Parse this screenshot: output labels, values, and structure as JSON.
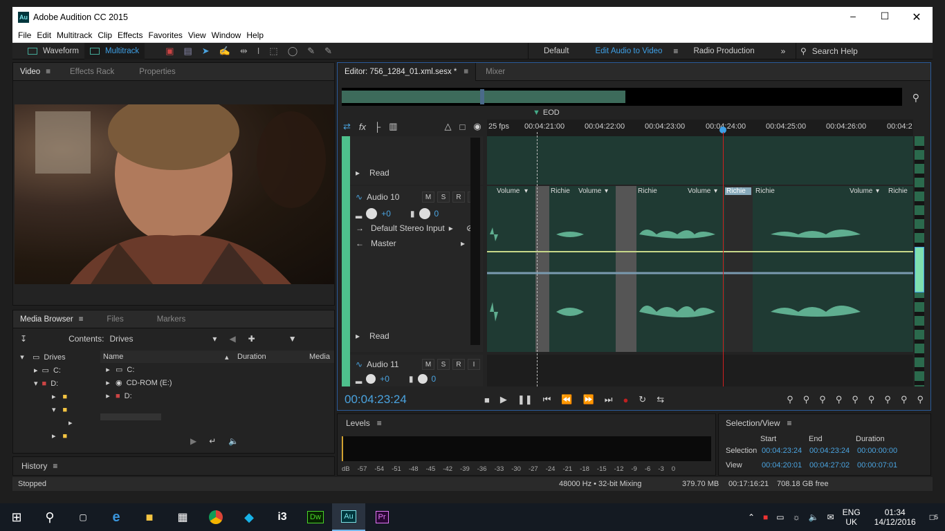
{
  "window": {
    "title": "Adobe Audition CC 2015",
    "app_badge": "Au"
  },
  "menu": [
    "File",
    "Edit",
    "Multitrack",
    "Clip",
    "Effects",
    "Favorites",
    "View",
    "Window",
    "Help"
  ],
  "toolbar": {
    "waveform": "Waveform",
    "multitrack": "Multitrack",
    "workspaces": [
      "Default",
      "Edit Audio to Video",
      "Radio Production"
    ],
    "search_help": "Search Help"
  },
  "left_tabs": {
    "video": "Video",
    "effects_rack": "Effects Rack",
    "properties": "Properties"
  },
  "media_tabs": {
    "media_browser": "Media Browser",
    "files": "Files",
    "markers": "Markers"
  },
  "media": {
    "contents_label": "Contents:",
    "contents_value": "Drives",
    "tree": {
      "drives": "Drives",
      "c": "C:",
      "d": "D:"
    },
    "columns": {
      "name": "Name",
      "duration": "Duration",
      "media": "Media"
    },
    "items": [
      "C:",
      "CD-ROM (E:)",
      "D:"
    ]
  },
  "history": "History",
  "status_left": "Stopped",
  "editor_tabs": {
    "editor": "Editor: 756_1284_01.xml.sesx *",
    "mixer": "Mixer"
  },
  "timeline": {
    "fps": "25 fps",
    "eod": "EOD",
    "ticks": [
      "00:04:21:00",
      "00:04:22:00",
      "00:04:23:00",
      "00:04:24:00",
      "00:04:25:00",
      "00:04:26:00",
      "00:04:2"
    ],
    "current_time": "00:04:23:24"
  },
  "track_top": {
    "mode": "Read"
  },
  "track_audio10": {
    "name": "Audio 10",
    "volume": "+0",
    "pan": "0",
    "input": "Default Stereo Input",
    "output": "Master",
    "mode": "Read",
    "m": "M",
    "s": "S",
    "r": "R",
    "i": "I",
    "clips": [
      "Volume",
      "Richie",
      "Volume",
      "Richie",
      "Volume",
      "Richie",
      "Richie",
      "Volume",
      "Richie"
    ]
  },
  "track_audio11": {
    "name": "Audio 11",
    "volume": "+0",
    "pan": "0",
    "m": "M",
    "s": "S",
    "r": "R",
    "i": "I"
  },
  "levels": {
    "title": "Levels",
    "scale": [
      "dB",
      "-57",
      "-54",
      "-51",
      "-48",
      "-45",
      "-42",
      "-39",
      "-36",
      "-33",
      "-30",
      "-27",
      "-24",
      "-21",
      "-18",
      "-15",
      "-12",
      "-9",
      "-6",
      "-3",
      "0"
    ]
  },
  "selection_view": {
    "title": "Selection/View",
    "headers": [
      "Start",
      "End",
      "Duration"
    ],
    "selection_label": "Selection",
    "selection": [
      "00:04:23:24",
      "00:04:23:24",
      "00:00:00:00"
    ],
    "view_label": "View",
    "view": [
      "00:04:20:01",
      "00:04:27:02",
      "00:00:07:01"
    ]
  },
  "status": {
    "sample": "48000 Hz • 32-bit Mixing",
    "size": "379.70 MB",
    "duration": "00:17:16:21",
    "free": "708.18 GB free"
  },
  "taskbar": {
    "lang1": "ENG",
    "lang2": "UK",
    "time": "01:34",
    "date": "14/12/2016",
    "notif": "5",
    "apps": [
      "Dw",
      "Au",
      "Pr"
    ]
  },
  "colors": {
    "accent": "#3ea0e6",
    "wave": "#5fae90",
    "track_bg": "#1f3a33",
    "playhead": "#d02020"
  }
}
